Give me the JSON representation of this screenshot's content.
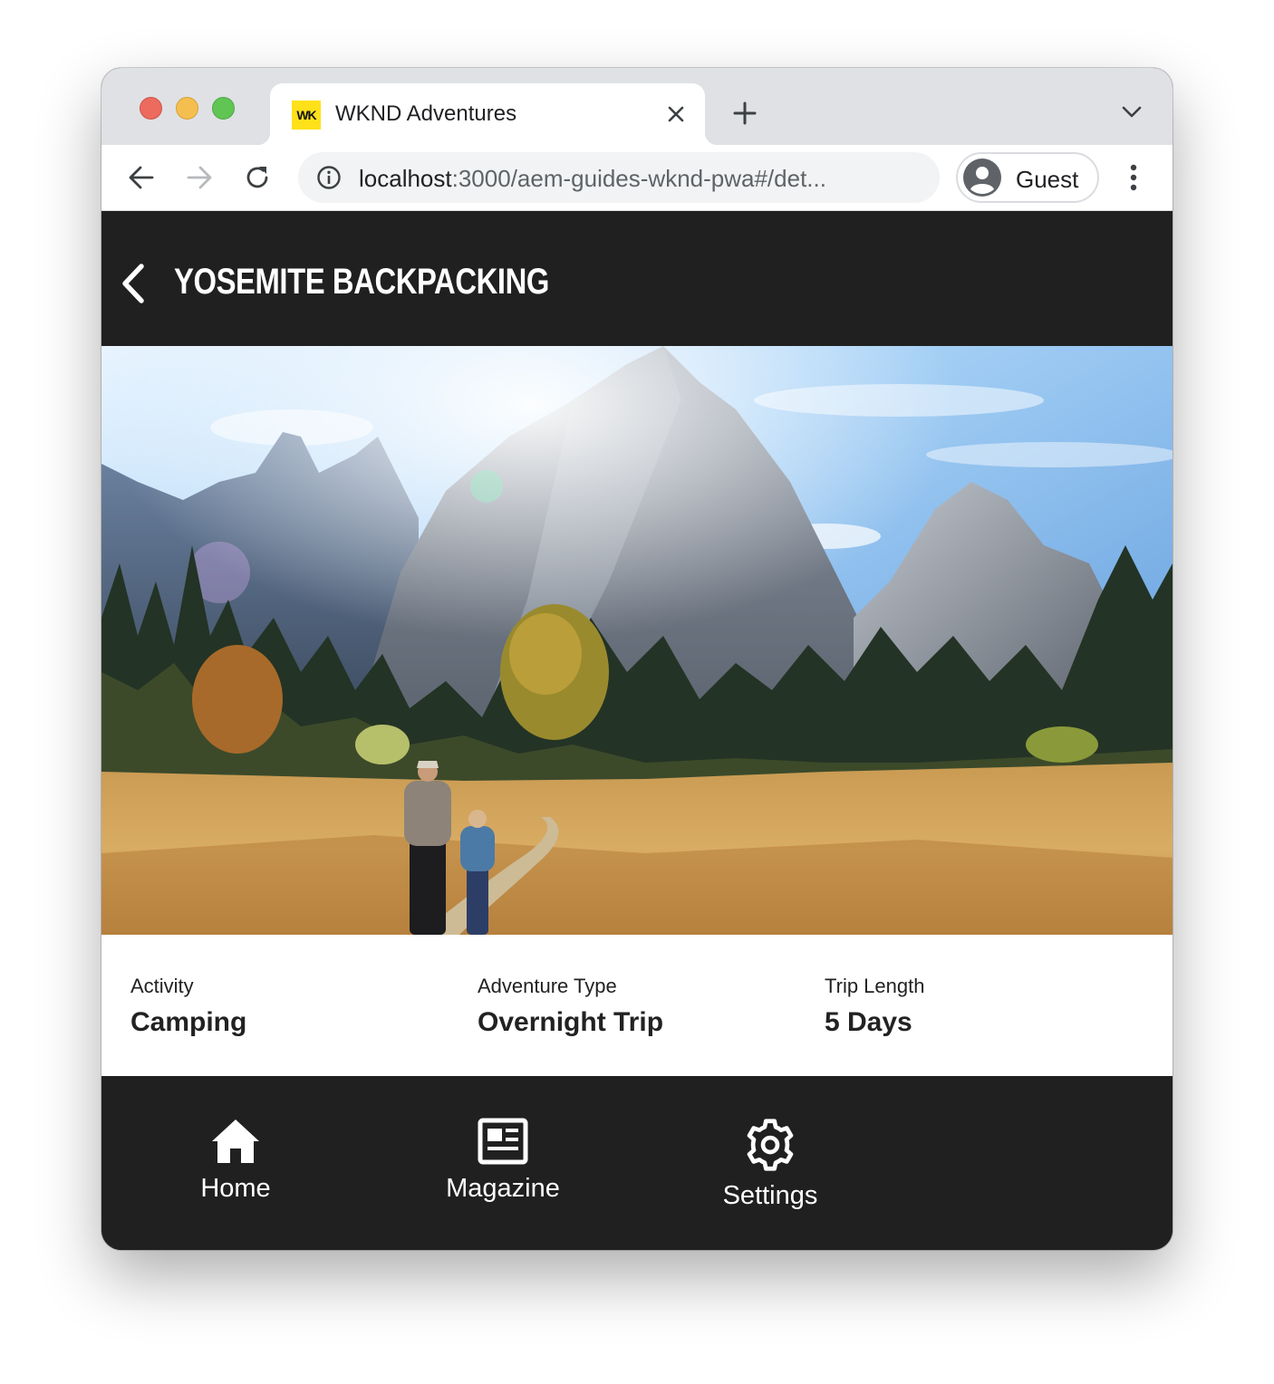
{
  "browser": {
    "tab_title": "WKND Adventures",
    "favicon_text": "WK",
    "url_host": "localhost",
    "url_rest": ":3000/aem-guides-wknd-pwa#/det...",
    "profile_name": "Guest",
    "icons": [
      "close-icon",
      "plus-icon",
      "chevron-down-icon",
      "back-arrow-icon",
      "forward-arrow-icon",
      "reload-icon",
      "info-icon",
      "avatar-icon",
      "kebab-menu-icon"
    ]
  },
  "page": {
    "title": "YOSEMITE BACKPACKING",
    "hero_image": "yosemite-mountain-meadow-photo",
    "details": [
      {
        "label": "Activity",
        "value": "Camping"
      },
      {
        "label": "Adventure Type",
        "value": "Overnight Trip"
      },
      {
        "label": "Trip Length",
        "value": "5 Days"
      }
    ]
  },
  "bottom_nav": {
    "items": [
      {
        "label": "Home",
        "icon": "home-icon"
      },
      {
        "label": "Magazine",
        "icon": "newspaper-icon"
      },
      {
        "label": "Settings",
        "icon": "gear-icon"
      }
    ]
  },
  "colors": {
    "appbar": "#202020",
    "favicon_bg": "#ffe11a",
    "tabstrip": "#dfe1e5"
  }
}
